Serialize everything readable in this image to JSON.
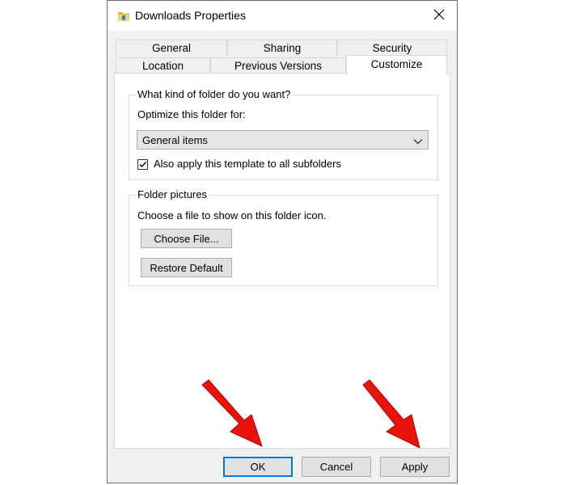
{
  "window": {
    "title": "Downloads Properties",
    "icon": "folder-icon",
    "close_icon": "close-icon"
  },
  "tabs": {
    "row1": [
      "General",
      "Sharing",
      "Security"
    ],
    "row2": [
      "Location",
      "Previous Versions",
      "Customize"
    ],
    "active": "Customize"
  },
  "folder_type": {
    "legend": "What kind of folder do you want?",
    "optimize_label": "Optimize this folder for:",
    "selected_value": "General items",
    "apply_subfolders_label": "Also apply this template to all subfolders",
    "apply_subfolders_checked": true
  },
  "folder_pictures": {
    "legend": "Folder pictures",
    "description": "Choose a file to show on this folder icon.",
    "choose_file_label": "Choose File...",
    "restore_default_label": "Restore Default"
  },
  "footer": {
    "ok_label": "OK",
    "cancel_label": "Cancel",
    "apply_label": "Apply"
  },
  "annotation": {
    "arrow_color": "#e8130c",
    "arrow_icon": "red-arrow-icon"
  }
}
